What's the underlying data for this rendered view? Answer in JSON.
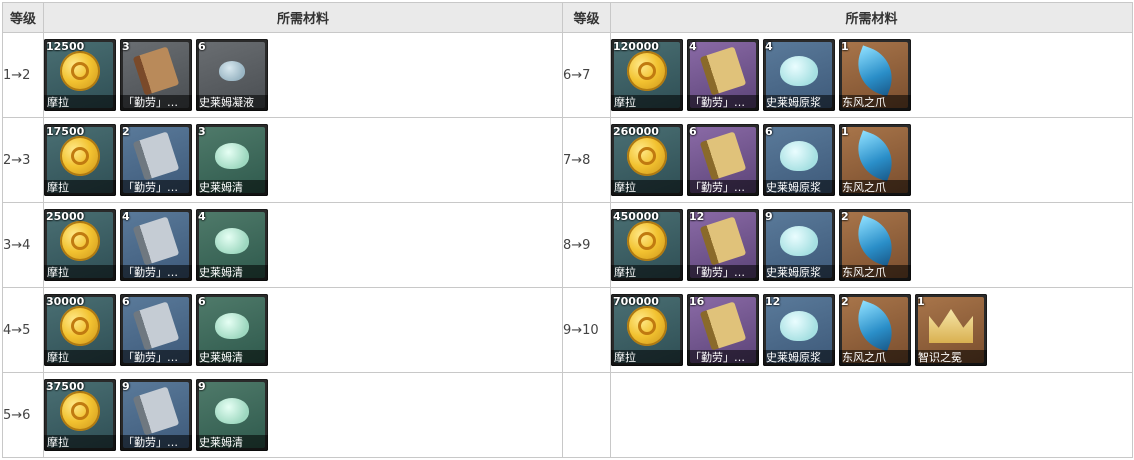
{
  "header": {
    "left_level": "等级",
    "left_materials": "所需材料",
    "right_level": "等级",
    "right_materials": "所需材料"
  },
  "rows": [
    {
      "left": {
        "level": "1→2",
        "items": [
          {
            "name": "摩拉",
            "count": "12500",
            "icon": "mora-coin-icon",
            "bg": "teal"
          },
          {
            "name": "「勤劳」…",
            "count": "3",
            "icon": "teachings-book-icon",
            "bg": "gray"
          },
          {
            "name": "史莱姆凝液",
            "count": "6",
            "icon": "slime-condensate-icon",
            "bg": "gray"
          }
        ]
      },
      "right": {
        "level": "6→7",
        "items": [
          {
            "name": "摩拉",
            "count": "120000",
            "icon": "mora-coin-icon",
            "bg": "teal"
          },
          {
            "name": "「勤劳」…",
            "count": "4",
            "icon": "philosophies-book-icon",
            "bg": "purple"
          },
          {
            "name": "史莱姆原浆",
            "count": "4",
            "icon": "slime-concentrate-icon",
            "bg": "blue"
          },
          {
            "name": "东风之爪",
            "count": "1",
            "icon": "dvalin-claw-icon",
            "bg": "orange"
          }
        ]
      }
    },
    {
      "left": {
        "level": "2→3",
        "items": [
          {
            "name": "摩拉",
            "count": "17500",
            "icon": "mora-coin-icon",
            "bg": "teal"
          },
          {
            "name": "「勤劳」…",
            "count": "2",
            "icon": "guide-book-icon",
            "bg": "blue"
          },
          {
            "name": "史莱姆清",
            "count": "3",
            "icon": "slime-secretion-icon",
            "bg": "green"
          }
        ]
      },
      "right": {
        "level": "7→8",
        "items": [
          {
            "name": "摩拉",
            "count": "260000",
            "icon": "mora-coin-icon",
            "bg": "teal"
          },
          {
            "name": "「勤劳」…",
            "count": "6",
            "icon": "philosophies-book-icon",
            "bg": "purple"
          },
          {
            "name": "史莱姆原浆",
            "count": "6",
            "icon": "slime-concentrate-icon",
            "bg": "blue"
          },
          {
            "name": "东风之爪",
            "count": "1",
            "icon": "dvalin-claw-icon",
            "bg": "orange"
          }
        ]
      }
    },
    {
      "left": {
        "level": "3→4",
        "items": [
          {
            "name": "摩拉",
            "count": "25000",
            "icon": "mora-coin-icon",
            "bg": "teal"
          },
          {
            "name": "「勤劳」…",
            "count": "4",
            "icon": "guide-book-icon",
            "bg": "blue"
          },
          {
            "name": "史莱姆清",
            "count": "4",
            "icon": "slime-secretion-icon",
            "bg": "green"
          }
        ]
      },
      "right": {
        "level": "8→9",
        "items": [
          {
            "name": "摩拉",
            "count": "450000",
            "icon": "mora-coin-icon",
            "bg": "teal"
          },
          {
            "name": "「勤劳」…",
            "count": "12",
            "icon": "philosophies-book-icon",
            "bg": "purple"
          },
          {
            "name": "史莱姆原浆",
            "count": "9",
            "icon": "slime-concentrate-icon",
            "bg": "blue"
          },
          {
            "name": "东风之爪",
            "count": "2",
            "icon": "dvalin-claw-icon",
            "bg": "orange"
          }
        ]
      }
    },
    {
      "left": {
        "level": "4→5",
        "items": [
          {
            "name": "摩拉",
            "count": "30000",
            "icon": "mora-coin-icon",
            "bg": "teal"
          },
          {
            "name": "「勤劳」…",
            "count": "6",
            "icon": "guide-book-icon",
            "bg": "blue"
          },
          {
            "name": "史莱姆清",
            "count": "6",
            "icon": "slime-secretion-icon",
            "bg": "green"
          }
        ]
      },
      "right": {
        "level": "9→10",
        "items": [
          {
            "name": "摩拉",
            "count": "700000",
            "icon": "mora-coin-icon",
            "bg": "teal"
          },
          {
            "name": "「勤劳」…",
            "count": "16",
            "icon": "philosophies-book-icon",
            "bg": "purple"
          },
          {
            "name": "史莱姆原浆",
            "count": "12",
            "icon": "slime-concentrate-icon",
            "bg": "blue"
          },
          {
            "name": "东风之爪",
            "count": "2",
            "icon": "dvalin-claw-icon",
            "bg": "orange"
          },
          {
            "name": "智识之冕",
            "count": "1",
            "icon": "crown-of-insight-icon",
            "bg": "orange"
          }
        ]
      }
    },
    {
      "left": {
        "level": "5→6",
        "items": [
          {
            "name": "摩拉",
            "count": "37500",
            "icon": "mora-coin-icon",
            "bg": "teal"
          },
          {
            "name": "「勤劳」…",
            "count": "9",
            "icon": "guide-book-icon",
            "bg": "blue"
          },
          {
            "name": "史莱姆清",
            "count": "9",
            "icon": "slime-secretion-icon",
            "bg": "green"
          }
        ]
      },
      "right": null
    }
  ]
}
